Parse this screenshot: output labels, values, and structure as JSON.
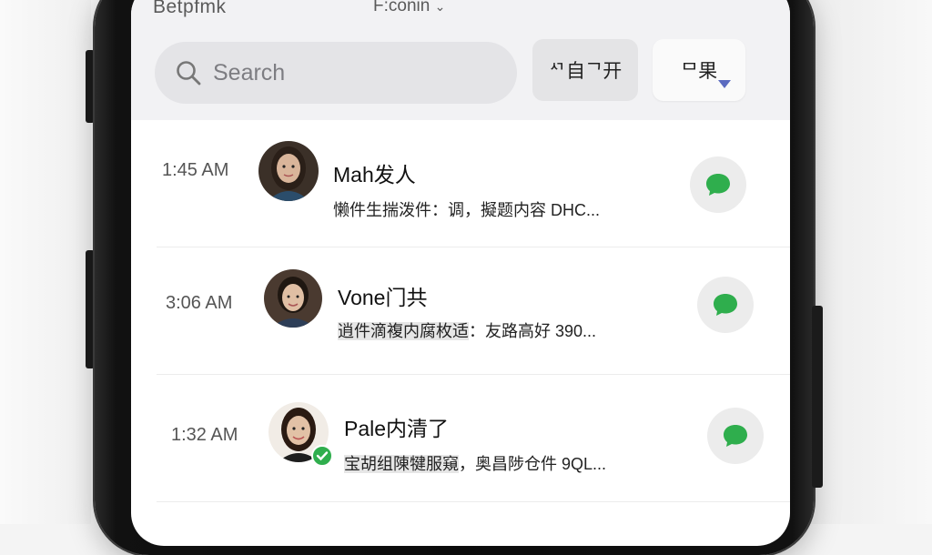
{
  "status_bar": {
    "left": "Betpfmk",
    "center": "F:conin",
    "center_caret": "⌄"
  },
  "search": {
    "placeholder": "Search",
    "icon": "search-icon"
  },
  "header_buttons": [
    {
      "label": "ᄭ自ᄀ开"
    },
    {
      "label": "ᄆ果",
      "icon": "dropdown-caret-icon"
    }
  ],
  "messages": [
    {
      "time": "1:45 AM",
      "name": "Mah发人",
      "preview_highlight": "",
      "preview_text": "懒件生揣泼件：调，擬题内容 DHC...",
      "action_icon": "chat-bubble-icon"
    },
    {
      "time": "3:06 AM",
      "name": "Vone门共",
      "preview_highlight": "逍件滴複内腐枚适",
      "preview_text": "：友路高好 390...",
      "action_icon": "chat-bubble-icon"
    },
    {
      "time": "1:32 AM",
      "name": "Pale内清了",
      "preview_highlight": "宝胡组陳犍服窺",
      "preview_text": "，奥昌陟仓件 9QL...",
      "action_icon": "chat-bubble-icon",
      "verified": true
    }
  ],
  "colors": {
    "accent_green": "#2fae4d",
    "caret_blue": "#5b6bc0"
  }
}
